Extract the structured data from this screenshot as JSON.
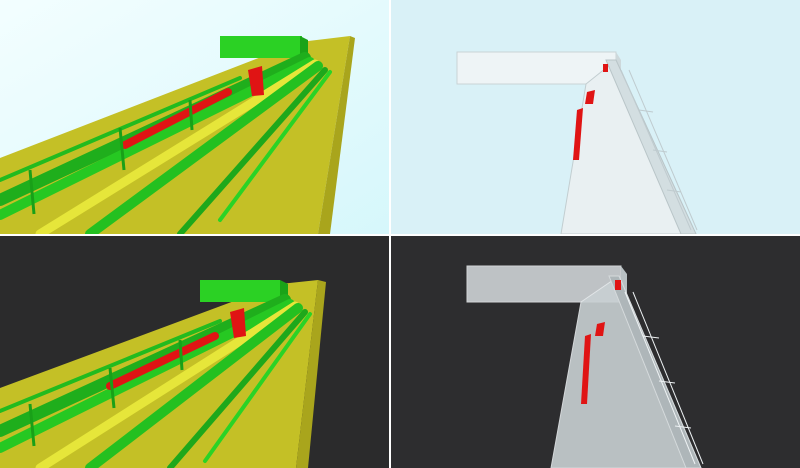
{
  "panels": [
    {
      "id": "top-left",
      "style": "colored",
      "background": "#e6fbff"
    },
    {
      "id": "top-right",
      "style": "transparent",
      "background": "#d9f1f7"
    },
    {
      "id": "bottom-left",
      "style": "colored",
      "background": "#2b2b2c"
    },
    {
      "id": "bottom-right",
      "style": "transparent",
      "background": "#2d2d2f"
    }
  ],
  "colors": {
    "slab": "#c9c52a",
    "slab_dark": "#a8a41e",
    "pipe_green": "#22c61e",
    "pipe_yellow": "#ecec3a",
    "pipe_red": "#e01414",
    "ghost": "#e8eef0"
  }
}
